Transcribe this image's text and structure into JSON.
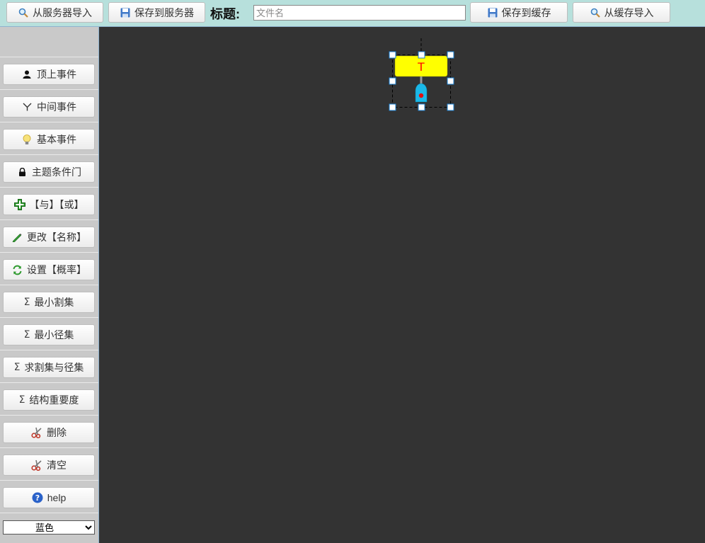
{
  "toolbar": {
    "import_server": "从服务器导入",
    "save_server": "保存到服务器",
    "title_label": "标题:",
    "filename_placeholder": "文件名",
    "filename_value": "",
    "save_cache": "保存到缓存",
    "import_cache": "从缓存导入"
  },
  "sidebar": {
    "items": [
      {
        "label": "顶上事件",
        "icon": "user-icon"
      },
      {
        "label": "中间事件",
        "icon": "fork-icon"
      },
      {
        "label": "基本事件",
        "icon": "bulb-icon"
      },
      {
        "label": "主题条件门",
        "icon": "lock-icon"
      },
      {
        "label": "【与】【或】",
        "icon": "plus-icon"
      },
      {
        "label": "更改【名称】",
        "icon": "pencil-icon"
      },
      {
        "label": "设置【概率】",
        "icon": "refresh-icon"
      },
      {
        "label": "最小割集",
        "icon": "sigma-icon"
      },
      {
        "label": "最小径集",
        "icon": "sigma-icon"
      },
      {
        "label": "求割集与径集",
        "icon": "sigma-icon"
      },
      {
        "label": "结构重要度",
        "icon": "sigma-icon"
      },
      {
        "label": "删除",
        "icon": "scissors-icon"
      },
      {
        "label": "清空",
        "icon": "scissors-icon"
      },
      {
        "label": "help",
        "icon": "help-icon"
      }
    ],
    "color_options": [
      "蓝色"
    ],
    "color_selected": "蓝色"
  },
  "canvas": {
    "node": {
      "label": "T",
      "fill": "#ffff00",
      "text_color": "#ff0000",
      "gate_color": "#1ab8e8"
    }
  }
}
